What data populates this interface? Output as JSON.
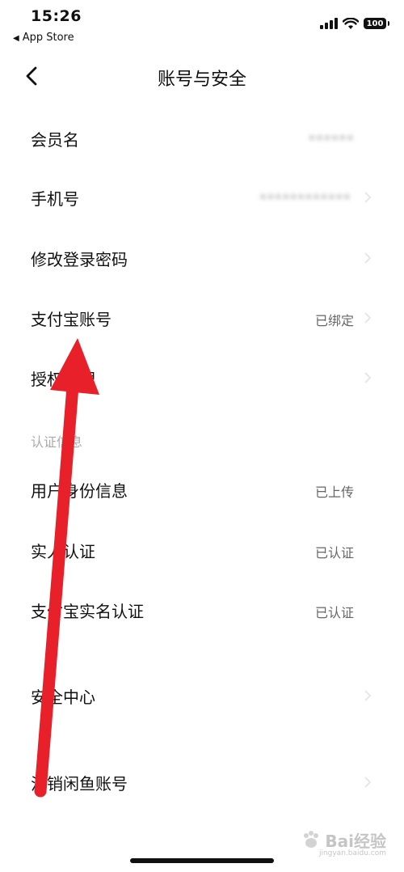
{
  "status_bar": {
    "time": "15:26",
    "back_app": "App Store",
    "battery": "100"
  },
  "nav": {
    "title": "账号与安全"
  },
  "rows": [
    {
      "label": "会员名",
      "value": "••••••",
      "value_blurred": true
    },
    {
      "label": "手机号",
      "value": "••••••••••••",
      "value_blurred": true
    },
    {
      "label": "修改登录密码",
      "value": ""
    },
    {
      "label": "支付宝账号",
      "value": "已绑定"
    },
    {
      "label": "授权管理",
      "value": ""
    }
  ],
  "auth_section": {
    "label": "认证信息",
    "rows": [
      {
        "label": "用户身份信息",
        "value": "已上传"
      },
      {
        "label": "实人认证",
        "value": "已认证"
      },
      {
        "label": "支付宝实名认证",
        "value": "已认证"
      }
    ]
  },
  "security_center": {
    "label": "安全中心"
  },
  "cancel_account": {
    "label": "注销闲鱼账号"
  },
  "watermark": {
    "text": "Bai经验",
    "sub": "jingyan.baidu.com"
  },
  "colors": {
    "arrow": "#e8202a",
    "chevron": "#e6e6e6",
    "value_text": "#666666"
  }
}
